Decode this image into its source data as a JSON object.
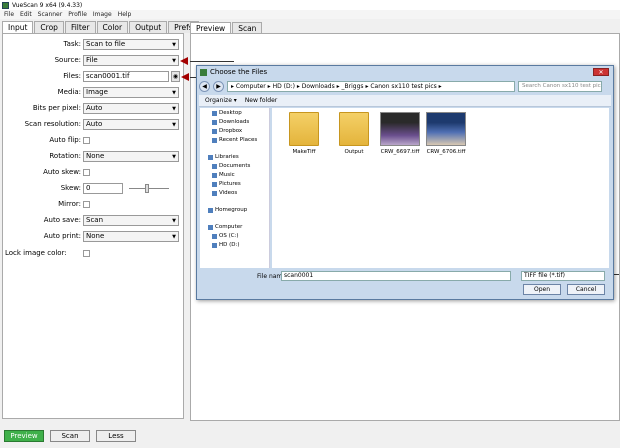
{
  "app": {
    "title": "VueScan 9 x64 (9.4.33)",
    "menu": [
      "File",
      "Edit",
      "Scanner",
      "Profile",
      "Image",
      "Help"
    ]
  },
  "left_tabs": [
    "Input",
    "Crop",
    "Filter",
    "Color",
    "Output",
    "Prefs"
  ],
  "right_tabs": [
    "Preview",
    "Scan"
  ],
  "input": {
    "task_label": "Task:",
    "task_value": "Scan to file",
    "source_label": "Source:",
    "source_value": "File",
    "files_label": "Files:",
    "files_value": "scan0001.tif",
    "media_label": "Media:",
    "media_value": "Image",
    "bits_label": "Bits per pixel:",
    "bits_value": "Auto",
    "resolution_label": "Scan resolution:",
    "resolution_value": "Auto",
    "autoflip_label": "Auto flip:",
    "rotation_label": "Rotation:",
    "rotation_value": "None",
    "autoskew_label": "Auto skew:",
    "skew_label": "Skew:",
    "skew_value": "0",
    "mirror_label": "Mirror:",
    "autosave_label": "Auto save:",
    "autosave_value": "Scan",
    "autoprint_label": "Auto print:",
    "autoprint_value": "None",
    "lockcolor_label": "Lock image color:"
  },
  "bottom": {
    "preview": "Preview",
    "scan": "Scan",
    "less": "Less"
  },
  "dialog": {
    "title": "Choose the Files",
    "close": "✕",
    "address": "▸ Computer ▸ HD (D:) ▸ Downloads ▸ _Briggs ▸ Canon sx110 test pics ▸",
    "search_placeholder": "Search Canon sx110 test pics",
    "organize": "Organize ▾",
    "new_folder": "New folder",
    "nav": {
      "desktop": "Desktop",
      "downloads": "Downloads",
      "dropbox": "Dropbox",
      "recent": "Recent Places",
      "libraries": "Libraries",
      "documents": "Documents",
      "music": "Music",
      "pictures": "Pictures",
      "videos": "Videos",
      "homegroup": "Homegroup",
      "computer": "Computer",
      "os_c": "OS (C:)",
      "hd_d": "HD (D:)"
    },
    "files": [
      "MakeTiff",
      "Output",
      "CRW_6697.tiff",
      "CRW_6706.tiff"
    ],
    "filename_label": "File name:",
    "filename_value": "scan0001",
    "filetype_value": "TIFF file (*.tif)",
    "open": "Open",
    "cancel": "Cancel"
  },
  "colors": {
    "arrow": "#a30000",
    "preview_button": "#3fb04a"
  }
}
